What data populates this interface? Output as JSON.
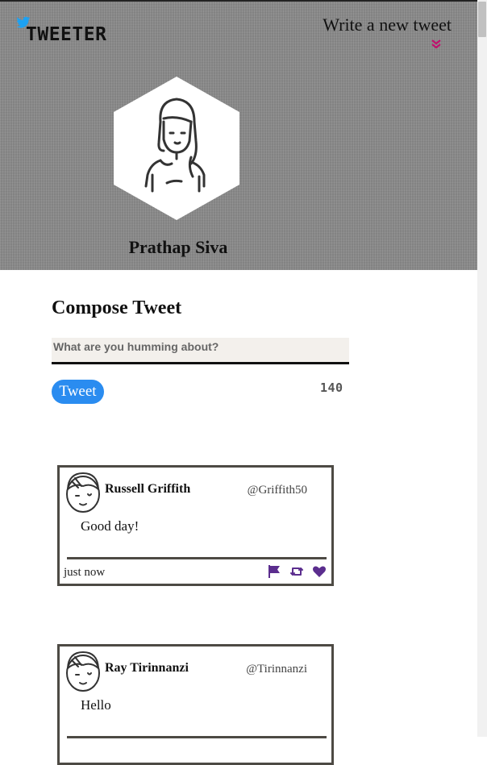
{
  "brand": {
    "name": "TWEETER",
    "accent": "#1da1f2"
  },
  "nav": {
    "write_label": "Write a new tweet",
    "arrow_color": "#c0106e"
  },
  "profile": {
    "name": "Prathap Siva"
  },
  "compose": {
    "title": "Compose Tweet",
    "placeholder": "What are you humming about?",
    "button_label": "Tweet",
    "char_count": "140",
    "button_color": "#2a8cf0"
  },
  "tweets": [
    {
      "name": "Russell Griffith",
      "handle": "@Griffith50",
      "text": "Good day!",
      "time": "just now"
    },
    {
      "name": "Ray Tirinnanzi",
      "handle": "@Tirinnanzi",
      "text": "Hello",
      "time": ""
    }
  ],
  "icons": {
    "flag": "flag-icon",
    "retweet": "retweet-icon",
    "like": "heart-icon",
    "action_color": "#5b2d8e"
  }
}
